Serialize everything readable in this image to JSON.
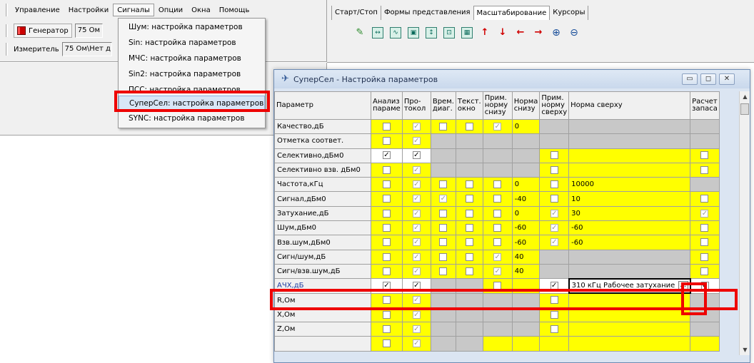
{
  "menu": {
    "items": [
      "Управление",
      "Настройки",
      "Сигналы",
      "Опции",
      "Окна",
      "Помощь"
    ],
    "open_index": 2
  },
  "generator": {
    "label": "Генератор",
    "value": "75 Ом"
  },
  "meter": {
    "label": "Измеритель",
    "value": "75 Ом\\Нет д"
  },
  "dropdown": {
    "items": [
      "Шум: настройка параметров",
      "Sin: настройка параметров",
      "МЧС: настройка параметров",
      "Sin2: настройка параметров",
      "ПСС: настройка параметров",
      "СуперСел: настройка параметров",
      "SYNC: настройка параметров"
    ],
    "highlighted_index": 5
  },
  "right_tabs": [
    "Старт/Стоп",
    "Формы представления",
    "Масштабирование",
    "Курсоры"
  ],
  "right_active_tab": 2,
  "toolbar_icons": [
    "pen-icon",
    "fit-horizontal-icon",
    "zoom-range-icon",
    "fit-box-icon",
    "fit-vertical-icon",
    "fit-all-icon",
    "fit-grid-icon",
    "arrow-up-icon",
    "arrow-down-icon",
    "arrow-left-icon",
    "arrow-right-icon",
    "zoom-in-icon",
    "zoom-out-icon"
  ],
  "dialog": {
    "title": "СуперСел - Настройка параметров",
    "columns": [
      "Параметр",
      "Анализ параме",
      "Про-токол",
      "Врем. диаг.",
      "Текст. окно",
      "Прим. норму снизу",
      "Норма снизу",
      "Прим. норму сверху",
      "Норма сверху",
      "Расчет запаса"
    ],
    "rows": [
      {
        "name": "Качество,дБ",
        "low": "0",
        "high": ""
      },
      {
        "name": "Отметка соответ.",
        "low": "",
        "high": ""
      },
      {
        "name": "Селективно,дБм0",
        "low": "",
        "high": ""
      },
      {
        "name": "Селективно взв. дБм0",
        "low": "",
        "high": ""
      },
      {
        "name": "Частота,кГц",
        "low": "0",
        "high": "10000"
      },
      {
        "name": "Сигнал,дБм0",
        "low": "-40",
        "high": "10"
      },
      {
        "name": "Затухание,дБ",
        "low": "0",
        "high": "30"
      },
      {
        "name": "Шум,дБм0",
        "low": "-60",
        "high": "-60"
      },
      {
        "name": "Взв.шум,дБм0",
        "low": "-60",
        "high": "-60"
      },
      {
        "name": "Сигн/шум,дБ",
        "low": "40",
        "high": ""
      },
      {
        "name": "Сигн/взв.шум,дБ",
        "low": "40",
        "high": ""
      },
      {
        "name": "АЧХ,дБ",
        "low": "",
        "high": "310 кГц Рабочее затухание"
      },
      {
        "name": "R,Ом",
        "low": "",
        "high": ""
      },
      {
        "name": "X,Ом",
        "low": "",
        "high": ""
      },
      {
        "name": "Z,Ом",
        "low": "",
        "high": ""
      },
      {
        "name": "",
        "low": "",
        "high": ""
      }
    ],
    "ellipsis": "..."
  },
  "colors": {
    "highlight_red": "#ee0000",
    "cell_yellow": "#ffff00",
    "cell_gray": "#c8c8c8"
  }
}
